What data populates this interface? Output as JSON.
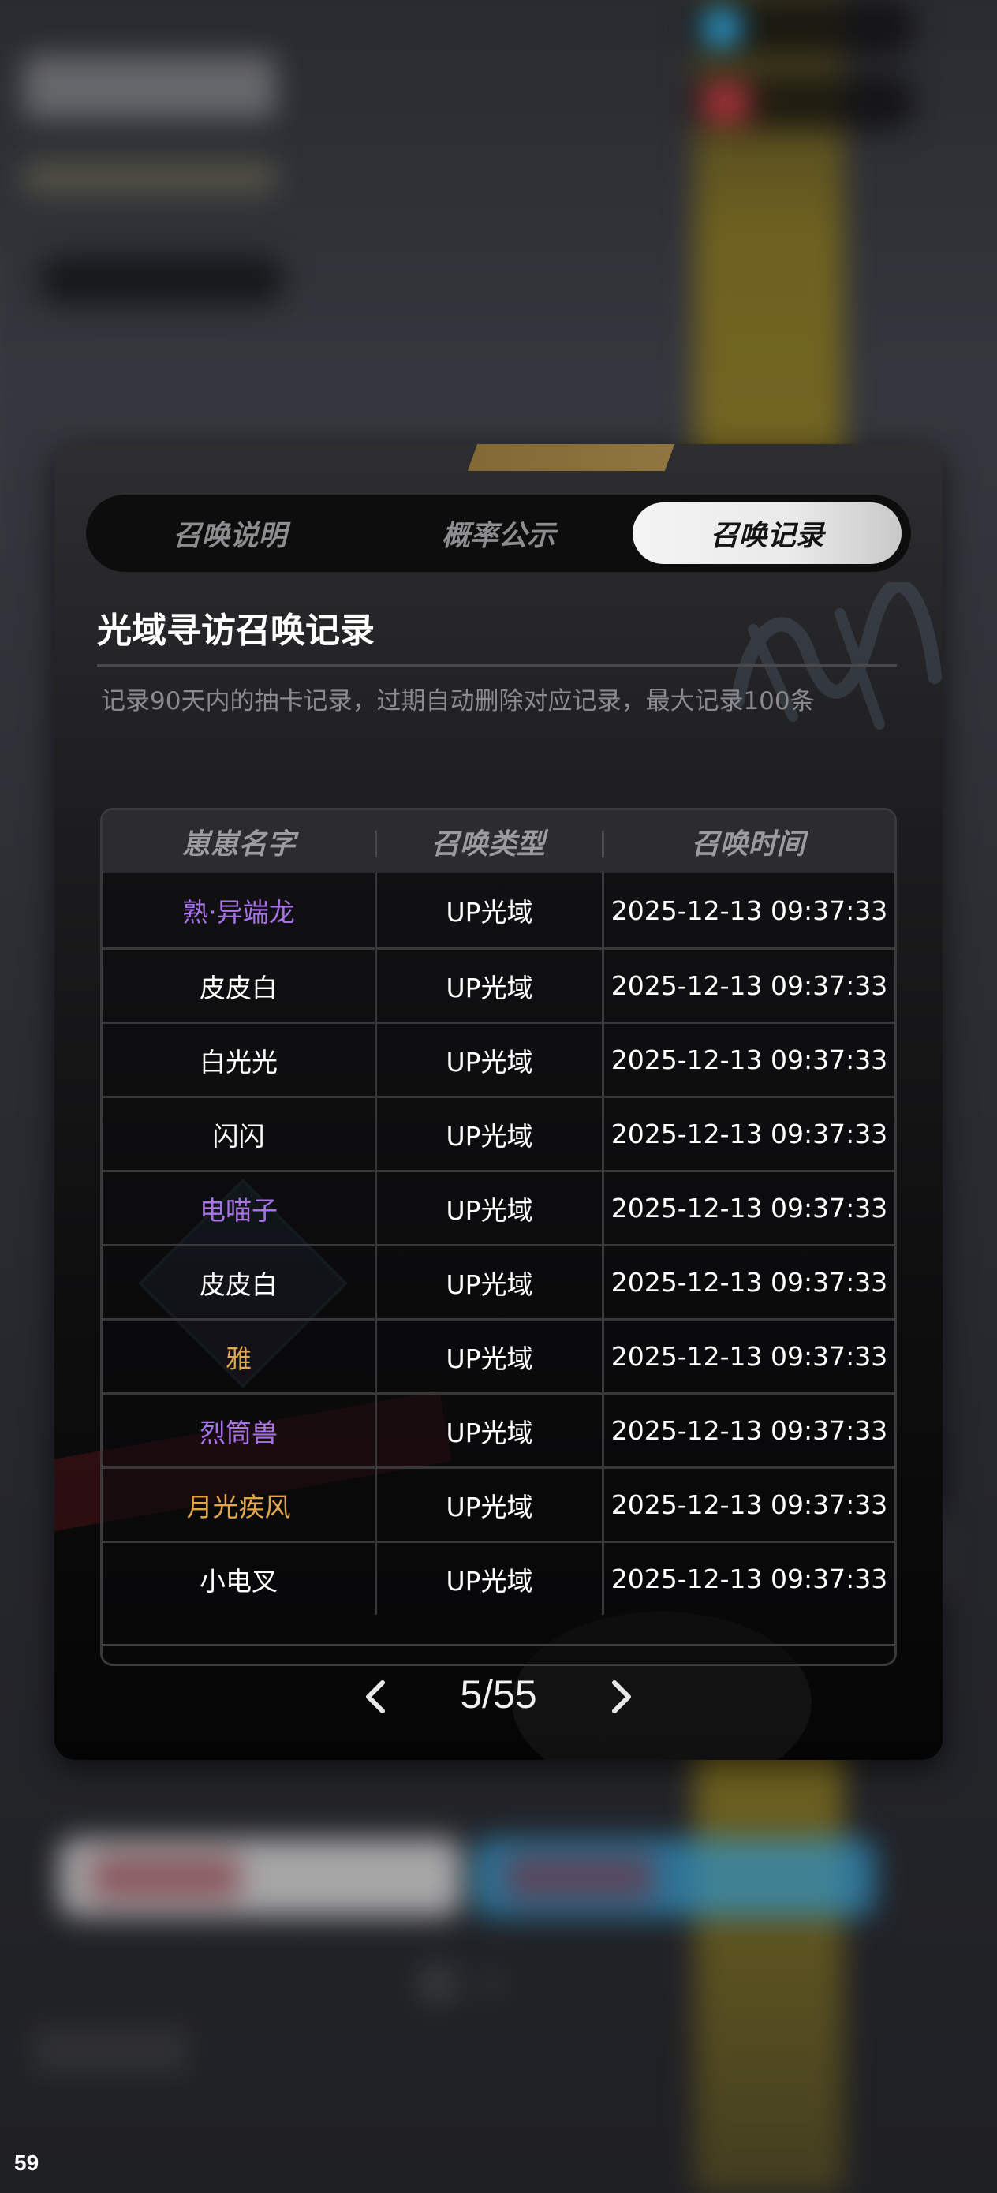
{
  "tabs": [
    {
      "label": "召唤说明",
      "active": false
    },
    {
      "label": "概率公示",
      "active": false
    },
    {
      "label": "召唤记录",
      "active": true
    }
  ],
  "record": {
    "title": "光域寻访召唤记录",
    "description": "记录90天内的抽卡记录，过期自动删除对应记录，最大记录100条"
  },
  "table": {
    "headers": [
      "崽崽名字",
      "召唤类型",
      "召唤时间"
    ],
    "rows": [
      {
        "name": "熟·异端龙",
        "type": "UP光域",
        "time": "2025-12-13 09:37:33",
        "name_color": "#a873e6"
      },
      {
        "name": "皮皮白",
        "type": "UP光域",
        "time": "2025-12-13 09:37:33",
        "name_color": "#ffffff"
      },
      {
        "name": "白光光",
        "type": "UP光域",
        "time": "2025-12-13 09:37:33",
        "name_color": "#ffffff"
      },
      {
        "name": "闪闪",
        "type": "UP光域",
        "time": "2025-12-13 09:37:33",
        "name_color": "#ffffff"
      },
      {
        "name": "电喵子",
        "type": "UP光域",
        "time": "2025-12-13 09:37:33",
        "name_color": "#a873e6"
      },
      {
        "name": "皮皮白",
        "type": "UP光域",
        "time": "2025-12-13 09:37:33",
        "name_color": "#ffffff"
      },
      {
        "name": "雅",
        "type": "UP光域",
        "time": "2025-12-13 09:37:33",
        "name_color": "#e3a64a"
      },
      {
        "name": "烈筒兽",
        "type": "UP光域",
        "time": "2025-12-13 09:37:33",
        "name_color": "#a873e6"
      },
      {
        "name": "月光疾风",
        "type": "UP光域",
        "time": "2025-12-13 09:37:33",
        "name_color": "#e3a64a"
      },
      {
        "name": "小电叉",
        "type": "UP光域",
        "time": "2025-12-13 09:37:33",
        "name_color": "#ffffff"
      }
    ]
  },
  "pagination": {
    "page_label": "5/55",
    "prev_icon": "chevron-left-icon",
    "next_icon": "chevron-right-icon"
  },
  "fps_counter": "59",
  "colors": {
    "rarity_purple": "#a873e6",
    "rarity_orange": "#e3a64a",
    "common_white": "#ffffff",
    "active_tab_bg": "#f0f0f0"
  }
}
